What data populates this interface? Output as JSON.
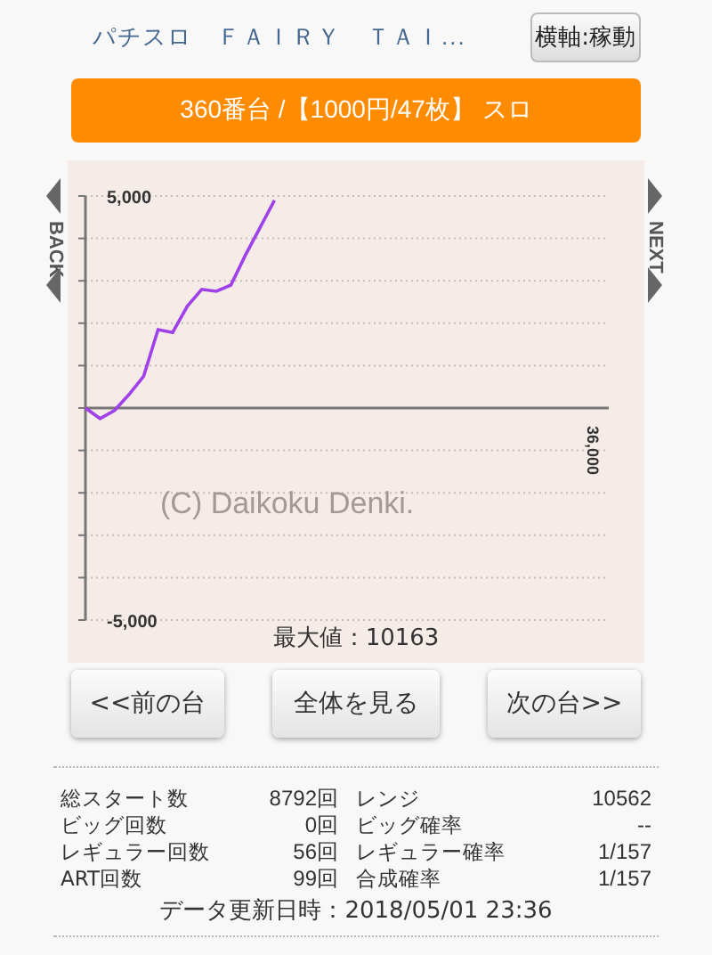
{
  "header": {
    "title": "パチスロ　ＦＡＩＲＹ　ＴＡＩ...",
    "axis_button": "横軸:稼動"
  },
  "machine_bar": "360番台 /【1000円/47枚】 スロ",
  "graph": {
    "back_label": "BACK",
    "next_label": "NEXT",
    "copyright": "(C) Daikoku Denki.",
    "max_label": "最大値：10163",
    "chart_data": {
      "type": "line",
      "series": [
        {
          "color": "#a040e8",
          "values": [
            0,
            -250,
            -60,
            320,
            750,
            1850,
            1780,
            2400,
            2800,
            2750,
            2900,
            3600,
            4250,
            4900,
            null,
            null,
            null,
            null,
            null,
            null,
            null,
            null,
            null,
            null,
            null,
            null,
            null,
            null,
            null,
            null,
            null,
            null,
            null,
            null,
            null,
            null,
            null
          ]
        }
      ],
      "ylim": [
        -5000,
        5000
      ],
      "annotations": [
        "36,000"
      ],
      "yticks": [
        {
          "value": 5000,
          "label": "5,000"
        },
        {
          "value": -5000,
          "label": "-5,000"
        }
      ]
    }
  },
  "nav_buttons": [
    "<<前の台",
    "全体を見る",
    "次の台>>"
  ],
  "stats": [
    {
      "label": "総スタート数",
      "value": "8792回",
      "label_2": "レンジ",
      "value_2": "10562"
    },
    {
      "label": "ビッグ回数",
      "value": "0回",
      "label_2": "ビッグ確率",
      "value_2": "--"
    },
    {
      "label": "レギュラー回数",
      "value": "56回",
      "label_2": "レギュラー確率",
      "value_2": "1/157"
    },
    {
      "label": "ART回数",
      "value": "99回",
      "label_2": "合成確率",
      "value_2": "1/157"
    }
  ],
  "updated": "データ更新日時：2018/05/01 23:36"
}
